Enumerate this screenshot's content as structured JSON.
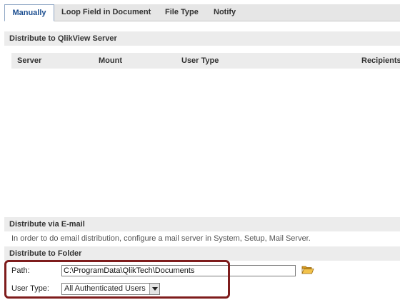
{
  "tabs": [
    {
      "label": "Manually",
      "active": true
    },
    {
      "label": "Loop Field in Document",
      "active": false
    },
    {
      "label": "File Type",
      "active": false
    },
    {
      "label": "Notify",
      "active": false
    }
  ],
  "qlikview_server": {
    "title": "Distribute to QlikView Server",
    "columns": [
      "Server",
      "Mount",
      "User Type",
      "Recipients"
    ]
  },
  "email": {
    "title": "Distribute via E-mail",
    "info": "In order to do email distribution, configure a mail server in System, Setup, Mail Server."
  },
  "folder": {
    "title": "Distribute to Folder",
    "path_label": "Path:",
    "path_value": "C:\\ProgramData\\QlikTech\\Documents",
    "user_type_label": "User Type:",
    "user_type_value": "All Authenticated Users"
  },
  "colors": {
    "active_tab_text": "#1d4f91",
    "highlight_border": "#7e1c1c",
    "section_bg": "#ececec",
    "folder_icon": "#e8b33a"
  },
  "icons": {
    "browse": "folder-open-icon",
    "dropdown": "chevron-down-icon"
  }
}
